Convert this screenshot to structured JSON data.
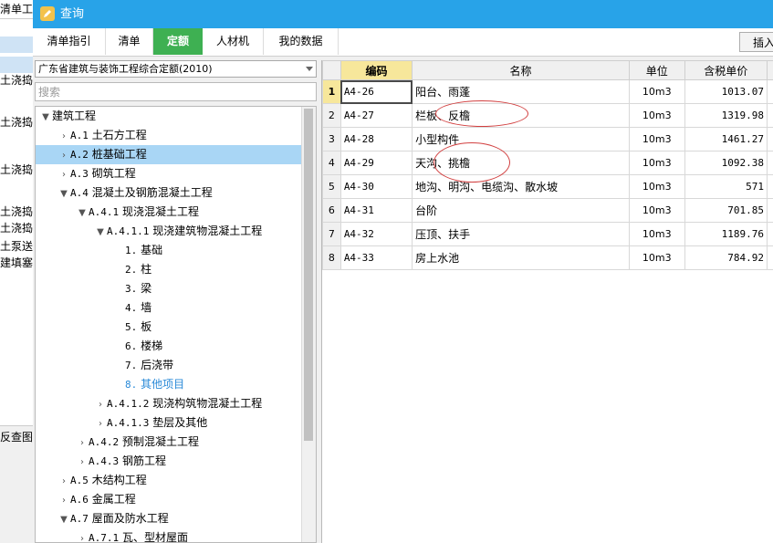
{
  "bg_app": {
    "header_text": "清单工作",
    "rows": [
      "土浇捣",
      "土浇捣",
      "土浇捣",
      "土浇捣",
      "土浇捣",
      "土泵送",
      "建填塞"
    ],
    "panel_label": "反查图"
  },
  "dialog": {
    "title": "查询"
  },
  "tabs": [
    {
      "label": "清单指引"
    },
    {
      "label": "清单"
    },
    {
      "label": "定额"
    },
    {
      "label": "人材机"
    },
    {
      "label": "我的数据"
    }
  ],
  "insert_button": "插入",
  "quota_library": {
    "selected": "广东省建筑与装饰工程综合定额(2010)"
  },
  "search": {
    "placeholder": "搜索",
    "value": ""
  },
  "tree": [
    {
      "code": "",
      "label": "建筑工程"
    },
    {
      "code": "A.1",
      "label": "土石方工程"
    },
    {
      "code": "A.2",
      "label": "桩基础工程"
    },
    {
      "code": "A.3",
      "label": "砌筑工程"
    },
    {
      "code": "A.4",
      "label": "混凝土及钢筋混凝土工程"
    },
    {
      "code": "A.4.1",
      "label": "现浇混凝土工程"
    },
    {
      "code": "A.4.1.1",
      "label": "现浇建筑物混凝土工程"
    },
    {
      "code": "1.",
      "label": "基础"
    },
    {
      "code": "2.",
      "label": "柱"
    },
    {
      "code": "3.",
      "label": "梁"
    },
    {
      "code": "4.",
      "label": "墙"
    },
    {
      "code": "5.",
      "label": "板"
    },
    {
      "code": "6.",
      "label": "楼梯"
    },
    {
      "code": "7.",
      "label": "后浇带"
    },
    {
      "code": "8.",
      "label": "其他项目"
    },
    {
      "code": "A.4.1.2",
      "label": "现浇构筑物混凝土工程"
    },
    {
      "code": "A.4.1.3",
      "label": "垫层及其他"
    },
    {
      "code": "A.4.2",
      "label": "预制混凝土工程"
    },
    {
      "code": "A.4.3",
      "label": "钢筋工程"
    },
    {
      "code": "A.5",
      "label": "木结构工程"
    },
    {
      "code": "A.6",
      "label": "金属工程"
    },
    {
      "code": "A.7",
      "label": "屋面及防水工程"
    },
    {
      "code": "A.7.1",
      "label": "瓦、型材屋面"
    }
  ],
  "grid": {
    "headers": {
      "code": "编码",
      "name": "名称",
      "unit": "单位",
      "price": "含税单价"
    },
    "rows": [
      {
        "no": "1",
        "code": "A4-26",
        "name": "阳台、雨蓬",
        "unit": "10m3",
        "price": "1013.07"
      },
      {
        "no": "2",
        "code": "A4-27",
        "name": "栏板、反檐",
        "unit": "10m3",
        "price": "1319.98"
      },
      {
        "no": "3",
        "code": "A4-28",
        "name": "小型构件",
        "unit": "10m3",
        "price": "1461.27"
      },
      {
        "no": "4",
        "code": "A4-29",
        "name": "天沟、挑檐",
        "unit": "10m3",
        "price": "1092.38"
      },
      {
        "no": "5",
        "code": "A4-30",
        "name": "地沟、明沟、电缆沟、散水坡",
        "unit": "10m3",
        "price": "571"
      },
      {
        "no": "6",
        "code": "A4-31",
        "name": "台阶",
        "unit": "10m3",
        "price": "701.85"
      },
      {
        "no": "7",
        "code": "A4-32",
        "name": "压顶、扶手",
        "unit": "10m3",
        "price": "1189.76"
      },
      {
        "no": "8",
        "code": "A4-33",
        "name": "房上水池",
        "unit": "10m3",
        "price": "784.92"
      }
    ]
  },
  "colors": {
    "title_bar": "#28a3e8",
    "active_tab": "#3eb052",
    "annotation": "#d24040"
  }
}
